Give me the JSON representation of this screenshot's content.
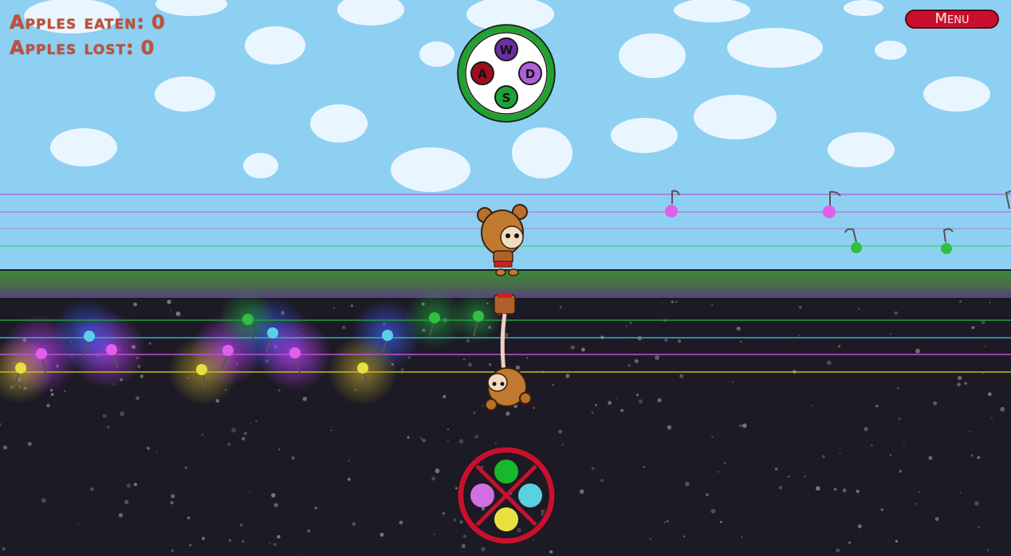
{
  "hud": {
    "eaten_label": "Apples eaten:",
    "eaten_value": "0",
    "lost_label": "Apples lost:",
    "lost_value": "0"
  },
  "menu": {
    "label": "Menu"
  },
  "key_wheel": {
    "keys": [
      {
        "label": "W",
        "color": "#6a2fa0"
      },
      {
        "label": "A",
        "color": "#9a1020"
      },
      {
        "label": "D",
        "color": "#b060d8"
      },
      {
        "label": "S",
        "color": "#1fa038"
      }
    ],
    "ring_color": "#22a030"
  },
  "catch_wheel": {
    "ring_color": "#c8102e",
    "dots": [
      {
        "name": "green",
        "color": "#18b82a"
      },
      {
        "name": "violet",
        "color": "#d070e0"
      },
      {
        "name": "cyan",
        "color": "#5ad0e0"
      },
      {
        "name": "yellow",
        "color": "#e8e040"
      }
    ]
  },
  "colors": {
    "sky": "#8ed0f2",
    "ground_top": "#3a8a3a",
    "ground_bottom": "#5a3a8a",
    "space": "#1c1a24"
  }
}
